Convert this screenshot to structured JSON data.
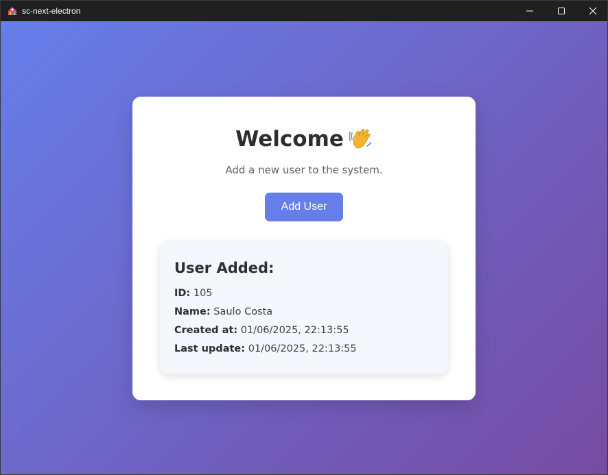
{
  "window": {
    "title": "sc-next-electron",
    "app_icon": "electron-app-icon",
    "controls": {
      "minimize": "minimize-icon",
      "maximize": "maximize-icon",
      "close": "close-icon"
    }
  },
  "card": {
    "heading": "Welcome",
    "heading_icon": "waving-hand-icon",
    "subtitle": "Add a new user to the system.",
    "add_button_label": "Add User"
  },
  "user_result": {
    "title": "User Added:",
    "fields": [
      {
        "label": "ID:",
        "value": "105"
      },
      {
        "label": "Name:",
        "value": "Saulo Costa"
      },
      {
        "label": "Created at:",
        "value": "01/06/2025, 22:13:55"
      },
      {
        "label": "Last update:",
        "value": "01/06/2025, 22:13:55"
      }
    ]
  },
  "colors": {
    "gradient_start": "#667eea",
    "gradient_end": "#764ba2",
    "button_bg": "#667eea",
    "titlebar_bg": "#202020"
  }
}
